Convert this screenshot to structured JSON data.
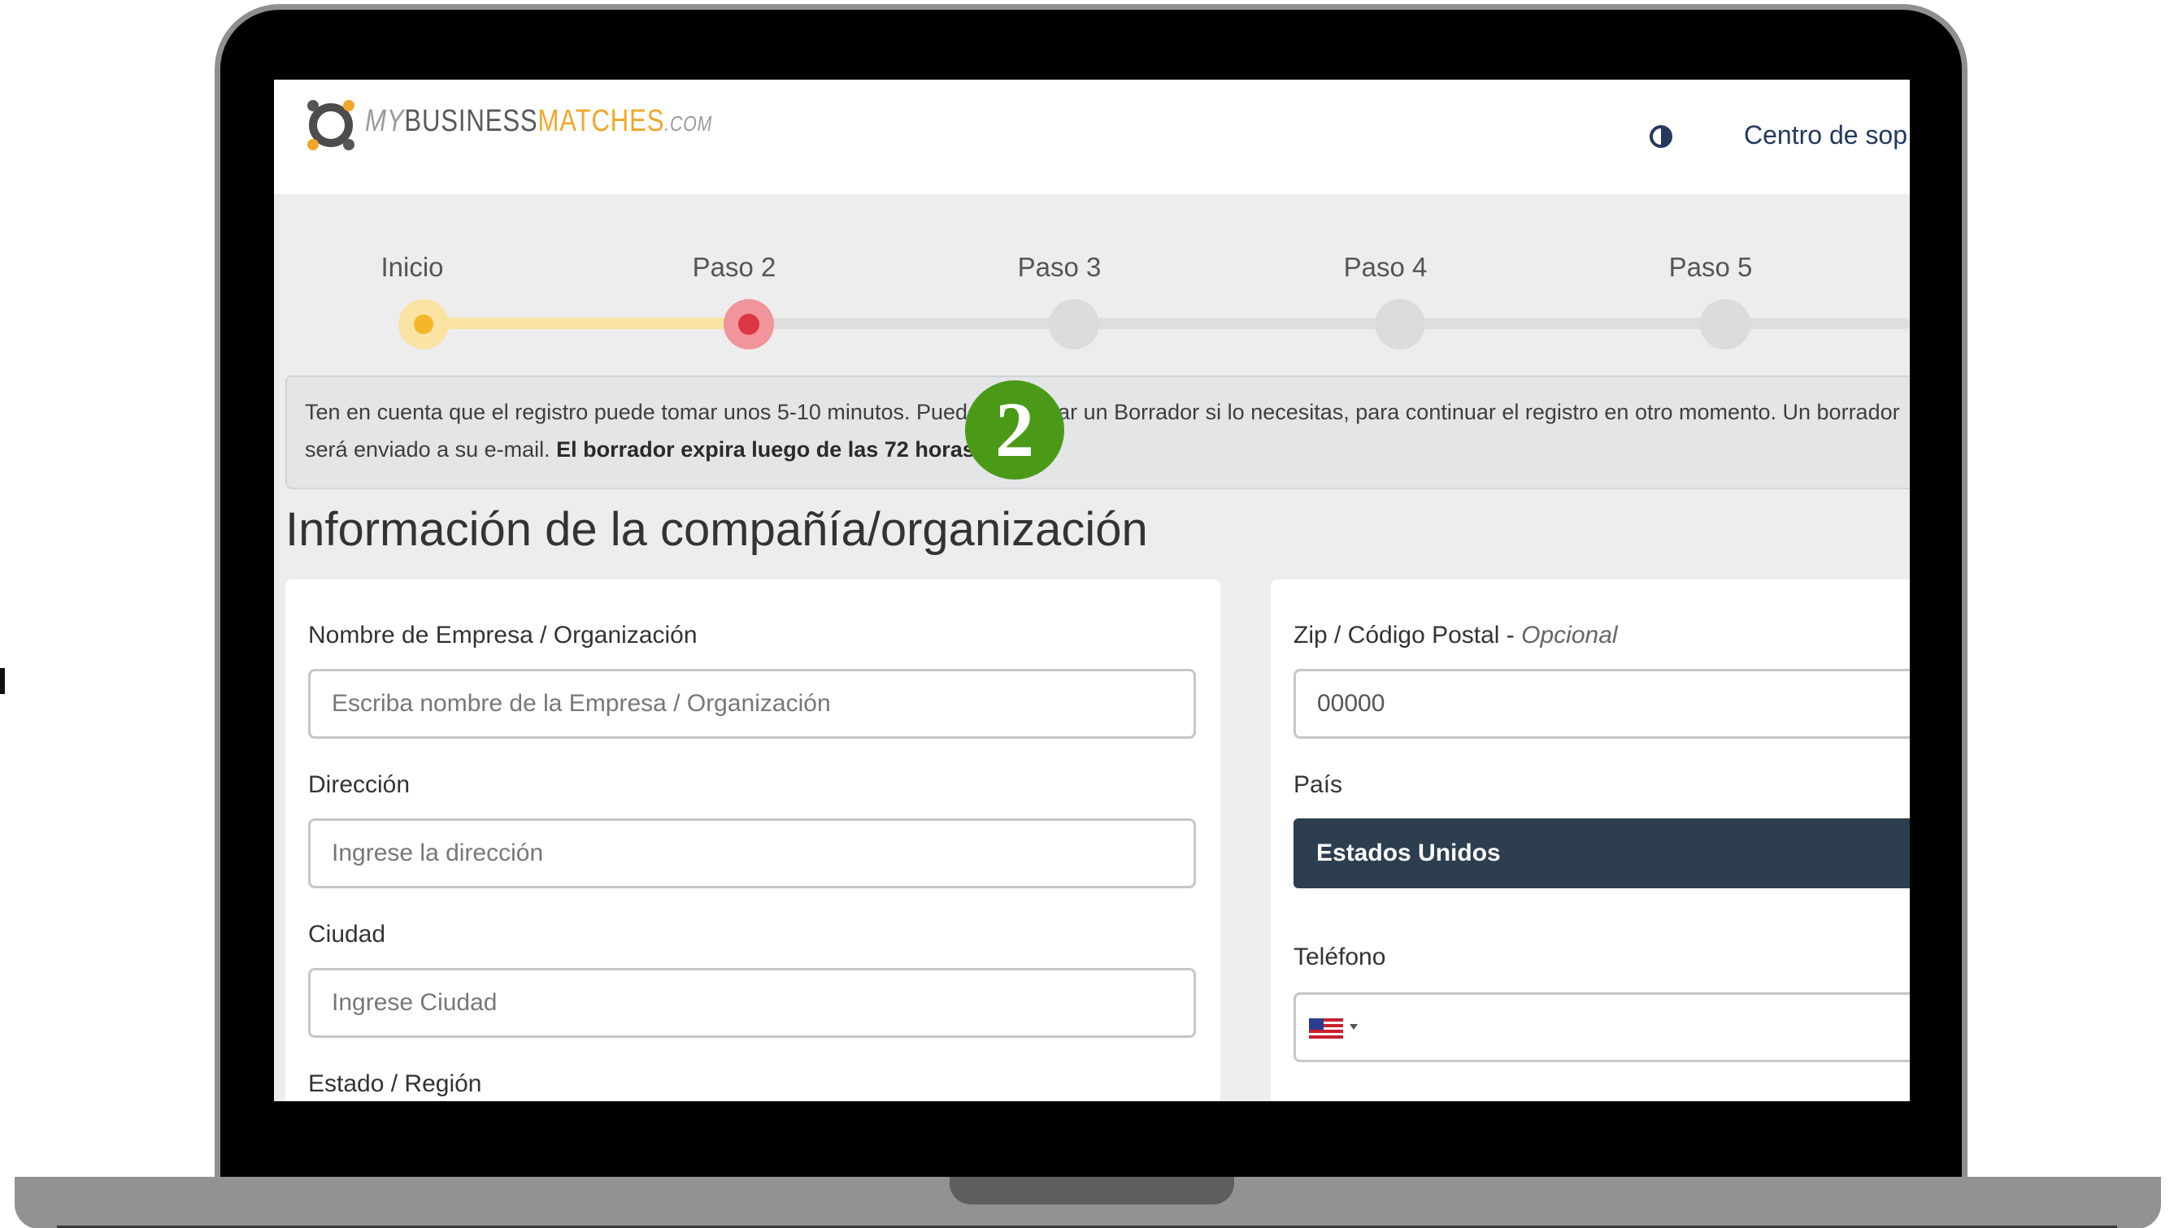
{
  "header": {
    "logo_my": "MY",
    "logo_business": "BUSINESS",
    "logo_matches": "MATCHES",
    "logo_com": ".COM",
    "contrast_icon": "contrast-icon",
    "support_link": "Centro de sop"
  },
  "stepper": {
    "steps": [
      "Inicio",
      "Paso 2",
      "Paso 3",
      "Paso 4",
      "Paso 5"
    ],
    "current_step": 2
  },
  "notice": {
    "text": "Ten en cuenta que el registro puede tomar unos 5-10 minutos. Puedes Guardar un Borrador si lo necesitas, para continuar el registro en otro momento. Un borrador será enviado a su e-mail.",
    "bold": "El borrador expira luego de las 72 horas."
  },
  "badge": "2",
  "section_title": "Información de la compañía/organización",
  "left_form": {
    "company_label": "Nombre de Empresa / Organización",
    "company_placeholder": "Escriba nombre de la Empresa / Organización",
    "address_label": "Dirección",
    "address_placeholder": "Ingrese la dirección",
    "city_label": "Ciudad",
    "city_placeholder": "Ingrese Ciudad",
    "state_label": "Estado / Región"
  },
  "right_form": {
    "zip_label": "Zip / Código Postal",
    "zip_optional": "Opcional",
    "zip_value": "00000",
    "country_label": "País",
    "country_value": "Estados Unidos",
    "phone_label": "Teléfono",
    "phone_flag_icon": "us-flag-icon"
  },
  "colors": {
    "brand_orange": "#f2a72b",
    "navy": "#23395d",
    "active_step": "#dc3545",
    "done_step": "#f6b62a",
    "badge_green": "#4a9a18",
    "select_bg": "#2c3e50"
  }
}
